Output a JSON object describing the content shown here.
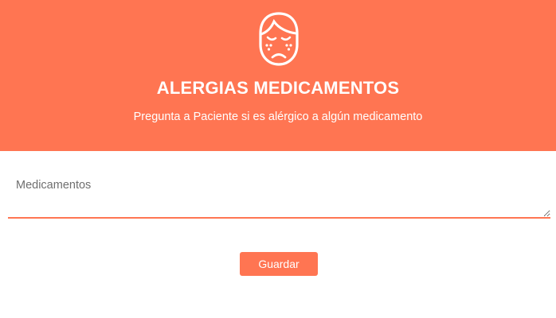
{
  "modal": {
    "icon": "sick-face-icon",
    "title": "ALERGIAS MEDICAMENTOS",
    "subtitle": "Pregunta a Paciente si es alérgico a algún medicamento"
  },
  "form": {
    "medications": {
      "placeholder": "Medicamentos",
      "value": ""
    },
    "save_label": "Guardar"
  },
  "colors": {
    "accent": "#ff7552",
    "header_text": "#ffffff",
    "placeholder_text": "#6f6f6f"
  }
}
